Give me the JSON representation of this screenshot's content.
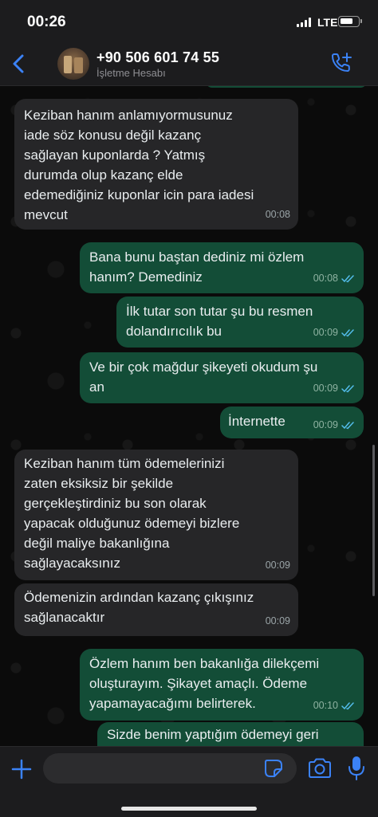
{
  "status_bar": {
    "time": "00:26",
    "network": "LTE"
  },
  "header": {
    "contact_name": "+90 506 601 74 55",
    "contact_subtitle": "İşletme Hesabı"
  },
  "messages": [
    {
      "direction": "in",
      "text": "Keziban hanım anlamıyormusunuz\niade söz konusu değil kazanç\nsağlayan kuponlarda ? Yatmış\ndurumda olup kazanç elde\nedemediğiniz kuponlar icin para iadesi\nmevcut",
      "time": "00:08"
    },
    {
      "direction": "out",
      "text": "Bana bunu baştan dediniz mi özlem\nhanım? Demediniz",
      "time": "00:08"
    },
    {
      "direction": "out",
      "text": "İlk tutar son tutar şu bu resmen\ndolandırıcılık bu",
      "time": "00:09"
    },
    {
      "direction": "out",
      "text": "Ve bir çok mağdur şikeyeti okudum şu\nan",
      "time": "00:09"
    },
    {
      "direction": "out",
      "text": "İnternette",
      "time": "00:09"
    },
    {
      "direction": "in",
      "text": "Keziban hanım tüm ödemelerinizi\nzaten eksiksiz bir şekilde\ngerçekleştirdiniz bu son olarak\nyapacak olduğunuz ödemeyi bizlere\ndeğil maliye bakanlığına\nsağlayacaksınız",
      "time": "00:09"
    },
    {
      "direction": "in",
      "text": "Ödemenizin ardından kazanç çıkışınız\nsağlanacaktır",
      "time": "00:09"
    },
    {
      "direction": "out",
      "text": "Özlem hanım ben bakanlığa dilekçemi\noluşturayım. Şikayet amaçlı. Ödeme\nyapamayacağımı belirterek.",
      "time": "00:10"
    },
    {
      "direction": "out",
      "text": "Sizde benim yaptığım ödemeyi geri",
      "time": ""
    }
  ],
  "input": {
    "value": "",
    "placeholder": ""
  },
  "icons": [
    "back-chevron-icon",
    "call-add-icon",
    "plus-icon",
    "sticker-icon",
    "camera-icon",
    "mic-icon",
    "double-check-icon"
  ],
  "colors": {
    "accent": "#3b82f6",
    "outgoing_bubble": "#134d37",
    "incoming_bubble": "#262628",
    "read_ticks": "#53bdeb"
  }
}
